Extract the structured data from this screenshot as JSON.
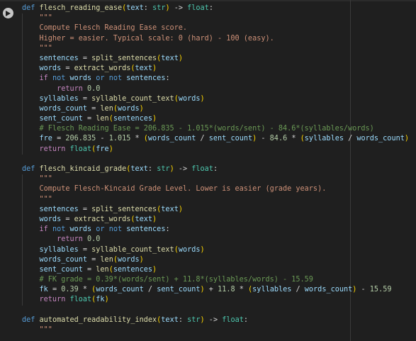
{
  "editor": {
    "run_button_icon": "play-icon",
    "lines": [
      [
        [
          "kw",
          "def "
        ],
        [
          "fn",
          "flesch_reading_ease"
        ],
        [
          "pn",
          "("
        ],
        [
          "var",
          "text"
        ],
        [
          "op",
          ": "
        ],
        [
          "ty",
          "str"
        ],
        [
          "pn",
          ")"
        ],
        [
          "op",
          " -> "
        ],
        [
          "ty",
          "float"
        ],
        [
          "op",
          ":"
        ]
      ],
      [
        [
          "str",
          "    \"\"\""
        ]
      ],
      [
        [
          "str",
          "    Compute Flesch Reading Ease score."
        ]
      ],
      [
        [
          "str",
          "    Higher = easier. Typical scale: 0 (hard) - 100 (easy)."
        ]
      ],
      [
        [
          "str",
          "    \"\"\""
        ]
      ],
      [
        [
          "var",
          "    sentences"
        ],
        [
          "op",
          " = "
        ],
        [
          "fn",
          "split_sentences"
        ],
        [
          "pn",
          "("
        ],
        [
          "var",
          "text"
        ],
        [
          "pn",
          ")"
        ]
      ],
      [
        [
          "var",
          "    words"
        ],
        [
          "op",
          " = "
        ],
        [
          "fn",
          "extract_words"
        ],
        [
          "pn",
          "("
        ],
        [
          "var",
          "text"
        ],
        [
          "pn",
          ")"
        ]
      ],
      [
        [
          "ctl",
          "    if "
        ],
        [
          "kw",
          "not "
        ],
        [
          "var",
          "words "
        ],
        [
          "kw",
          "or "
        ],
        [
          "kw",
          "not "
        ],
        [
          "var",
          "sentences"
        ],
        [
          "op",
          ":"
        ]
      ],
      [
        [
          "ctl",
          "        return "
        ],
        [
          "num",
          "0.0"
        ]
      ],
      [
        [
          "var",
          "    syllables"
        ],
        [
          "op",
          " = "
        ],
        [
          "fn",
          "syllable_count_text"
        ],
        [
          "pn",
          "("
        ],
        [
          "var",
          "words"
        ],
        [
          "pn",
          ")"
        ]
      ],
      [
        [
          "var",
          "    words_count"
        ],
        [
          "op",
          " = "
        ],
        [
          "fn",
          "len"
        ],
        [
          "pn",
          "("
        ],
        [
          "var",
          "words"
        ],
        [
          "pn",
          ")"
        ]
      ],
      [
        [
          "var",
          "    sent_count"
        ],
        [
          "op",
          " = "
        ],
        [
          "fn",
          "len"
        ],
        [
          "pn",
          "("
        ],
        [
          "var",
          "sentences"
        ],
        [
          "pn",
          ")"
        ]
      ],
      [
        [
          "cmt",
          "    # Flesch Reading Ease = 206.835 - 1.015*(words/sent) - 84.6*(syllables/words)"
        ]
      ],
      [
        [
          "var",
          "    fre"
        ],
        [
          "op",
          " = "
        ],
        [
          "num",
          "206.835"
        ],
        [
          "op",
          " - "
        ],
        [
          "num",
          "1.015"
        ],
        [
          "op",
          " * "
        ],
        [
          "pn",
          "("
        ],
        [
          "var",
          "words_count"
        ],
        [
          "op",
          " / "
        ],
        [
          "var",
          "sent_count"
        ],
        [
          "pn",
          ")"
        ],
        [
          "op",
          " - "
        ],
        [
          "num",
          "84.6"
        ],
        [
          "op",
          " * "
        ],
        [
          "pn",
          "("
        ],
        [
          "var",
          "syllables"
        ],
        [
          "op",
          " / "
        ],
        [
          "var",
          "words_count"
        ],
        [
          "pn",
          ")"
        ]
      ],
      [
        [
          "ctl",
          "    return "
        ],
        [
          "ty",
          "float"
        ],
        [
          "pn",
          "("
        ],
        [
          "var",
          "fre"
        ],
        [
          "pn",
          ")"
        ]
      ],
      [],
      [
        [
          "kw",
          "def "
        ],
        [
          "fn",
          "flesch_kincaid_grade"
        ],
        [
          "pn",
          "("
        ],
        [
          "var",
          "text"
        ],
        [
          "op",
          ": "
        ],
        [
          "ty",
          "str"
        ],
        [
          "pn",
          ")"
        ],
        [
          "op",
          " -> "
        ],
        [
          "ty",
          "float"
        ],
        [
          "op",
          ":"
        ]
      ],
      [
        [
          "str",
          "    \"\"\""
        ]
      ],
      [
        [
          "str",
          "    Compute Flesch-Kincaid Grade Level. Lower is easier (grade years)."
        ]
      ],
      [
        [
          "str",
          "    \"\"\""
        ]
      ],
      [
        [
          "var",
          "    sentences"
        ],
        [
          "op",
          " = "
        ],
        [
          "fn",
          "split_sentences"
        ],
        [
          "pn",
          "("
        ],
        [
          "var",
          "text"
        ],
        [
          "pn",
          ")"
        ]
      ],
      [
        [
          "var",
          "    words"
        ],
        [
          "op",
          " = "
        ],
        [
          "fn",
          "extract_words"
        ],
        [
          "pn",
          "("
        ],
        [
          "var",
          "text"
        ],
        [
          "pn",
          ")"
        ]
      ],
      [
        [
          "ctl",
          "    if "
        ],
        [
          "kw",
          "not "
        ],
        [
          "var",
          "words "
        ],
        [
          "kw",
          "or "
        ],
        [
          "kw",
          "not "
        ],
        [
          "var",
          "sentences"
        ],
        [
          "op",
          ":"
        ]
      ],
      [
        [
          "ctl",
          "        return "
        ],
        [
          "num",
          "0.0"
        ]
      ],
      [
        [
          "var",
          "    syllables"
        ],
        [
          "op",
          " = "
        ],
        [
          "fn",
          "syllable_count_text"
        ],
        [
          "pn",
          "("
        ],
        [
          "var",
          "words"
        ],
        [
          "pn",
          ")"
        ]
      ],
      [
        [
          "var",
          "    words_count"
        ],
        [
          "op",
          " = "
        ],
        [
          "fn",
          "len"
        ],
        [
          "pn",
          "("
        ],
        [
          "var",
          "words"
        ],
        [
          "pn",
          ")"
        ]
      ],
      [
        [
          "var",
          "    sent_count"
        ],
        [
          "op",
          " = "
        ],
        [
          "fn",
          "len"
        ],
        [
          "pn",
          "("
        ],
        [
          "var",
          "sentences"
        ],
        [
          "pn",
          ")"
        ]
      ],
      [
        [
          "cmt",
          "    # FK grade = 0.39*(words/sent) + 11.8*(syllables/words) - 15.59"
        ]
      ],
      [
        [
          "var",
          "    fk"
        ],
        [
          "op",
          " = "
        ],
        [
          "num",
          "0.39"
        ],
        [
          "op",
          " * "
        ],
        [
          "pn",
          "("
        ],
        [
          "var",
          "words_count"
        ],
        [
          "op",
          " / "
        ],
        [
          "var",
          "sent_count"
        ],
        [
          "pn",
          ")"
        ],
        [
          "op",
          " + "
        ],
        [
          "num",
          "11.8"
        ],
        [
          "op",
          " * "
        ],
        [
          "pn",
          "("
        ],
        [
          "var",
          "syllables"
        ],
        [
          "op",
          " / "
        ],
        [
          "var",
          "words_count"
        ],
        [
          "pn",
          ")"
        ],
        [
          "op",
          " - "
        ],
        [
          "num",
          "15.59"
        ]
      ],
      [
        [
          "ctl",
          "    return "
        ],
        [
          "ty",
          "float"
        ],
        [
          "pn",
          "("
        ],
        [
          "var",
          "fk"
        ],
        [
          "pn",
          ")"
        ]
      ],
      [],
      [
        [
          "kw",
          "def "
        ],
        [
          "fn",
          "automated_readability_index"
        ],
        [
          "pn",
          "("
        ],
        [
          "var",
          "text"
        ],
        [
          "op",
          ": "
        ],
        [
          "ty",
          "str"
        ],
        [
          "pn",
          ")"
        ],
        [
          "op",
          " -> "
        ],
        [
          "ty",
          "float"
        ],
        [
          "op",
          ":"
        ]
      ],
      [
        [
          "str",
          "    \"\"\""
        ]
      ]
    ]
  }
}
